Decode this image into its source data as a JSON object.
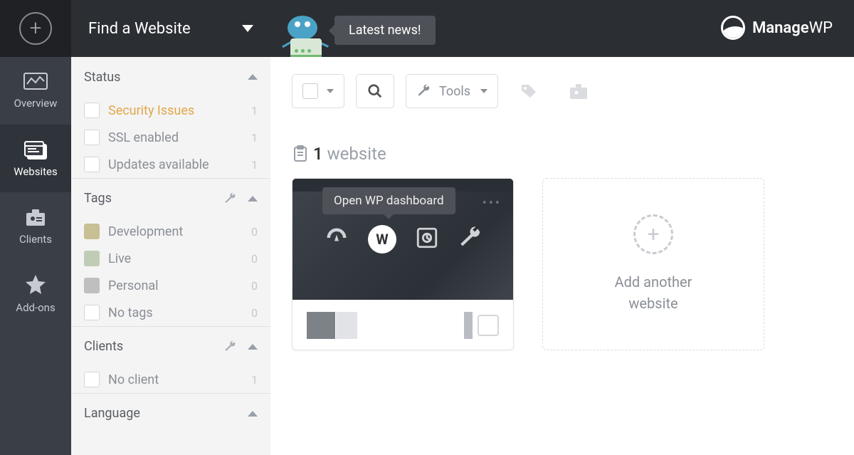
{
  "topbar": {
    "find_label": "Find a Website",
    "news_label": "Latest news!",
    "brand_bold": "Manage",
    "brand_thin": "WP"
  },
  "rail": {
    "overview": "Overview",
    "websites": "Websites",
    "clients": "Clients",
    "addons": "Add-ons"
  },
  "filters": {
    "status": {
      "title": "Status",
      "items": [
        {
          "label": "Security Issues",
          "count": "1",
          "hl": true
        },
        {
          "label": "SSL enabled",
          "count": "1"
        },
        {
          "label": "Updates available",
          "count": "1"
        }
      ]
    },
    "tags": {
      "title": "Tags",
      "items": [
        {
          "label": "Development",
          "count": "0",
          "swatch": "#c9bf94"
        },
        {
          "label": "Live",
          "count": "0",
          "swatch": "#c0cdb6"
        },
        {
          "label": "Personal",
          "count": "0",
          "swatch": "#bfbfbf"
        },
        {
          "label": "No tags",
          "count": "0",
          "swatch": null
        }
      ]
    },
    "clients": {
      "title": "Clients",
      "items": [
        {
          "label": "No client",
          "count": "1"
        }
      ]
    },
    "language": {
      "title": "Language"
    }
  },
  "toolbar": {
    "tools_label": "Tools"
  },
  "main": {
    "count_num": "1",
    "count_word": "website",
    "tooltip": "Open WP dashboard",
    "wp_glyph": "W",
    "add_line1": "Add another",
    "add_line2": "website"
  }
}
